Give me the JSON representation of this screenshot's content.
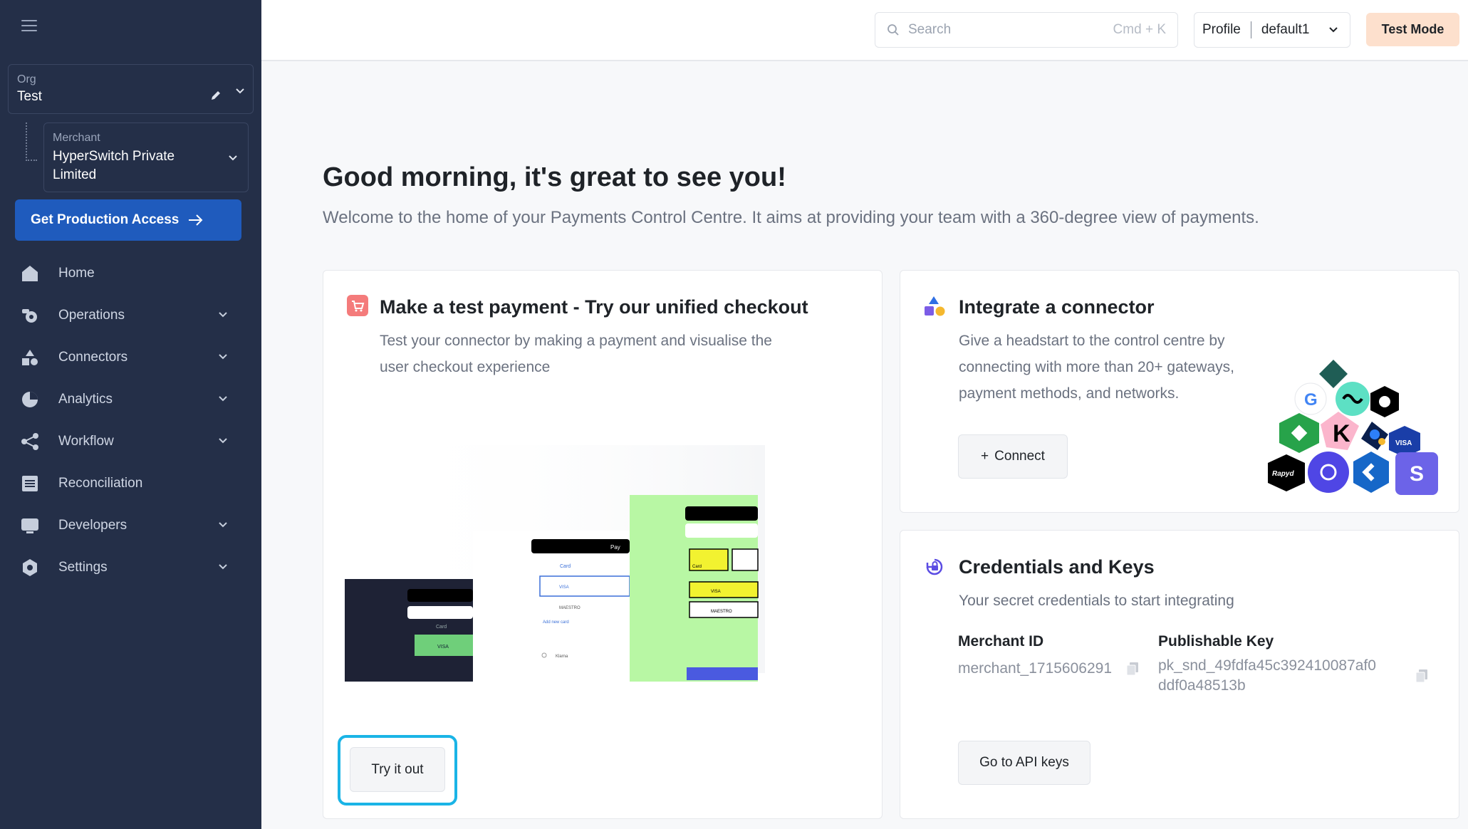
{
  "sidebar": {
    "org": {
      "label": "Org",
      "name": "Test"
    },
    "merchant": {
      "label": "Merchant",
      "name": "HyperSwitch Private Limited"
    },
    "production_button": "Get Production Access",
    "nav": [
      {
        "label": "Home",
        "icon": "home-icon",
        "expandable": false
      },
      {
        "label": "Operations",
        "icon": "operations-icon",
        "expandable": true
      },
      {
        "label": "Connectors",
        "icon": "connectors-icon",
        "expandable": true
      },
      {
        "label": "Analytics",
        "icon": "analytics-icon",
        "expandable": true
      },
      {
        "label": "Workflow",
        "icon": "workflow-icon",
        "expandable": true
      },
      {
        "label": "Reconciliation",
        "icon": "reconciliation-icon",
        "expandable": false
      },
      {
        "label": "Developers",
        "icon": "developers-icon",
        "expandable": true
      },
      {
        "label": "Settings",
        "icon": "settings-icon",
        "expandable": true
      }
    ]
  },
  "topbar": {
    "search_placeholder": "Search",
    "search_shortcut": "Cmd + K",
    "profile_label": "Profile",
    "profile_value": "default1",
    "mode_button": "Test Mode"
  },
  "main": {
    "greeting": "Good morning, it's great to see you!",
    "welcome": "Welcome to the home of your Payments Control Centre. It aims at providing your team with a 360-degree view of payments."
  },
  "cards": {
    "test_payment": {
      "title": "Make a test payment - Try our unified checkout",
      "description": "Test your connector by making a payment and visualise the user checkout experience",
      "button": "Try it out",
      "preview_labels": {
        "card": "Card",
        "visa": "VISA",
        "maestro": "MAESTRO",
        "add_card": "Add new card",
        "klarna": "Klarna",
        "gpay": "Pay"
      }
    },
    "connector": {
      "title": "Integrate a connector",
      "description": "Give a headstart to the control centre by connecting with more than 20+ gateways, payment methods, and networks.",
      "button": "Connect",
      "logo_labels": {
        "rapyd": "Rapyd",
        "visa": "VISA",
        "stripe": "S",
        "klarna": "K",
        "google": "G"
      }
    },
    "credentials": {
      "title": "Credentials and Keys",
      "description": "Your secret credentials to start integrating",
      "merchant_id_label": "Merchant ID",
      "merchant_id_value": "merchant_1715606291",
      "publishable_key_label": "Publishable Key",
      "publishable_key_line1": "pk_snd_49fdfa45c392410087af0",
      "publishable_key_line2": "ddf0a48513b",
      "button": "Go to API keys"
    }
  },
  "colors": {
    "sidebar_bg": "#242f48",
    "primary": "#1f5bbd",
    "test_mode_bg": "#fde0cd",
    "focus_ring": "#1ab4e6"
  }
}
